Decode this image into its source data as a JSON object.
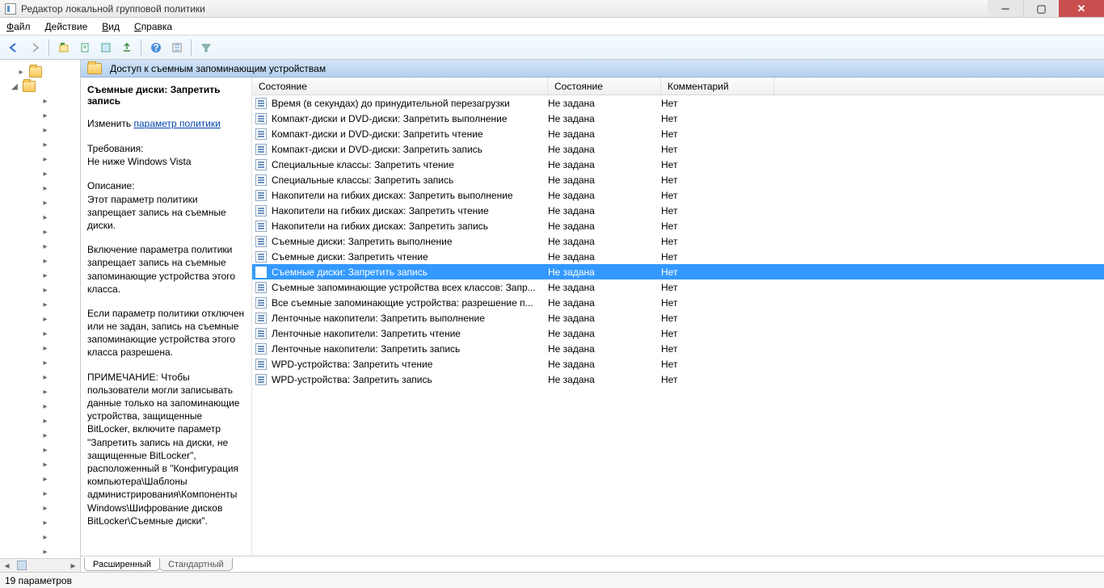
{
  "title": "Редактор локальной групповой политики",
  "menu": {
    "file": "Файл",
    "action": "Действие",
    "view": "Вид",
    "help": "Справка"
  },
  "path_header": "Доступ к съемным запоминающим устройствам",
  "details": {
    "title": "Съемные диски: Запретить запись",
    "edit_label": "Изменить",
    "edit_link": "параметр политики",
    "req_label": "Требования:",
    "req_text": "Не ниже Windows Vista",
    "desc_label": "Описание:",
    "desc_text": "Этот параметр политики запрещает запись на съемные диски.",
    "p2": "Включение параметра политики запрещает запись на съемные запоминающие устройства этого класса.",
    "p3": "Если параметр политики отключен или не задан, запись на съемные запоминающие устройства этого класса разрешена.",
    "p4": "ПРИМЕЧАНИЕ: Чтобы пользователи могли записывать данные только на запоминающие устройства, защищенные BitLocker, включите параметр \"Запретить запись на диски, не защищенные BitLocker\", расположенный в \"Конфигурация компьютера\\Шаблоны администрирования\\Компоненты Windows\\Шифрование дисков BitLocker\\Съемные диски\"."
  },
  "columns": {
    "c1": "Состояние",
    "c2": "Состояние",
    "c3": "Комментарий"
  },
  "rows": [
    {
      "name": "Время (в секундах) до принудительной перезагрузки",
      "state": "Не задана",
      "comment": "Нет"
    },
    {
      "name": "Компакт-диски и DVD-диски: Запретить выполнение",
      "state": "Не задана",
      "comment": "Нет"
    },
    {
      "name": "Компакт-диски и DVD-диски: Запретить чтение",
      "state": "Не задана",
      "comment": "Нет"
    },
    {
      "name": "Компакт-диски и DVD-диски: Запретить запись",
      "state": "Не задана",
      "comment": "Нет"
    },
    {
      "name": "Специальные классы: Запретить чтение",
      "state": "Не задана",
      "comment": "Нет"
    },
    {
      "name": "Специальные классы: Запретить запись",
      "state": "Не задана",
      "comment": "Нет"
    },
    {
      "name": "Накопители на гибких дисках: Запретить выполнение",
      "state": "Не задана",
      "comment": "Нет"
    },
    {
      "name": "Накопители на гибких дисках: Запретить чтение",
      "state": "Не задана",
      "comment": "Нет"
    },
    {
      "name": "Накопители на гибких дисках: Запретить запись",
      "state": "Не задана",
      "comment": "Нет"
    },
    {
      "name": "Съемные диски: Запретить выполнение",
      "state": "Не задана",
      "comment": "Нет"
    },
    {
      "name": "Съемные диски: Запретить чтение",
      "state": "Не задана",
      "comment": "Нет"
    },
    {
      "name": "Съемные диски: Запретить запись",
      "state": "Не задана",
      "comment": "Нет",
      "selected": true
    },
    {
      "name": "Съемные запоминающие устройства всех классов: Запр...",
      "state": "Не задана",
      "comment": "Нет"
    },
    {
      "name": "Все съемные запоминающие устройства: разрешение п...",
      "state": "Не задана",
      "comment": "Нет"
    },
    {
      "name": "Ленточные накопители: Запретить выполнение",
      "state": "Не задана",
      "comment": "Нет"
    },
    {
      "name": "Ленточные накопители: Запретить чтение",
      "state": "Не задана",
      "comment": "Нет"
    },
    {
      "name": "Ленточные накопители: Запретить запись",
      "state": "Не задана",
      "comment": "Нет"
    },
    {
      "name": "WPD-устройства: Запретить чтение",
      "state": "Не задана",
      "comment": "Нет"
    },
    {
      "name": "WPD-устройства: Запретить запись",
      "state": "Не задана",
      "comment": "Нет"
    }
  ],
  "tabs": {
    "extended": "Расширенный",
    "standard": "Стандартный"
  },
  "status": "19 параметров"
}
